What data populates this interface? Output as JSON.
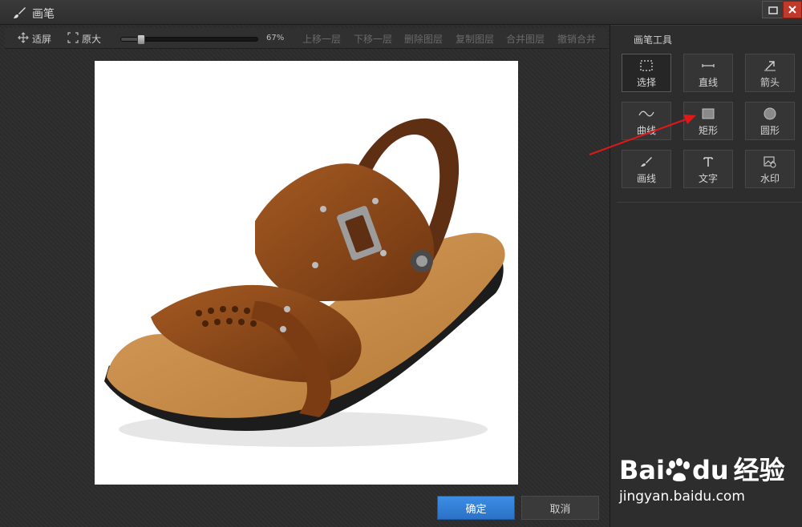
{
  "window": {
    "title": "画笔"
  },
  "toolbar": {
    "fit_label": "适屏",
    "original_label": "原大",
    "zoom_percent": 67,
    "zoom_text": "67%",
    "move_up_label": "上移一层",
    "move_down_label": "下移一层",
    "delete_layer_label": "删除图层",
    "copy_layer_label": "复制图层",
    "merge_layer_label": "合并图层",
    "unmerge_label": "撤销合并"
  },
  "panel": {
    "title": "画笔工具",
    "tools": [
      {
        "label": "选择",
        "icon": "select-icon",
        "selected": true
      },
      {
        "label": "直线",
        "icon": "line-icon"
      },
      {
        "label": "箭头",
        "icon": "arrow-icon"
      },
      {
        "label": "曲线",
        "icon": "curve-icon"
      },
      {
        "label": "矩形",
        "icon": "rectangle-icon"
      },
      {
        "label": "圆形",
        "icon": "circle-icon"
      },
      {
        "label": "画线",
        "icon": "brush-icon"
      },
      {
        "label": "文字",
        "icon": "text-icon"
      },
      {
        "label": "水印",
        "icon": "watermark-icon"
      }
    ]
  },
  "actions": {
    "ok_label": "确定",
    "cancel_label": "取消"
  },
  "watermark": {
    "brand": "Bai",
    "brand2": "du",
    "cn": "经验",
    "url": "jingyan.baidu.com"
  },
  "colors": {
    "accent": "#2a72c7",
    "close": "#c0392b",
    "annotation_arrow": "#e01818",
    "sandal": "#8a4a1a",
    "sole": "#c78a4a"
  }
}
